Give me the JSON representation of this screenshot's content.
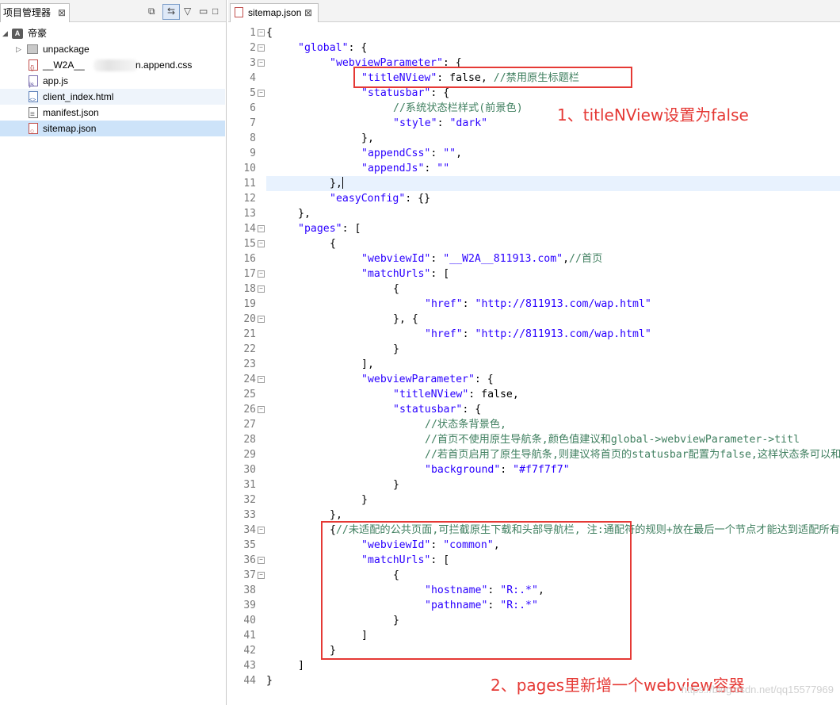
{
  "explorer": {
    "tab_title": "项目管理器",
    "items": [
      {
        "label": "帝豪",
        "type": "project"
      },
      {
        "label": "unpackage",
        "type": "folder"
      },
      {
        "label_prefix": "__W2A__",
        "label_suffix": "n.append.css",
        "type": "css"
      },
      {
        "label": "app.js",
        "type": "js"
      },
      {
        "label": "client_index.html",
        "type": "html"
      },
      {
        "label": "manifest.json",
        "type": "json"
      },
      {
        "label": "sitemap.json",
        "type": "json",
        "selected": true
      }
    ]
  },
  "editor": {
    "tab_title": "sitemap.json",
    "active_line": 11,
    "lines": [
      {
        "num": "1",
        "fold": true,
        "indent": 0,
        "tokens": [
          {
            "t": "{",
            "c": "p"
          }
        ]
      },
      {
        "num": "2",
        "fold": true,
        "indent": 1,
        "tokens": [
          {
            "t": "\"global\"",
            "c": "k"
          },
          {
            "t": ": {",
            "c": "p"
          }
        ]
      },
      {
        "num": "3",
        "fold": true,
        "indent": 2,
        "tokens": [
          {
            "t": "\"webviewParameter\"",
            "c": "k"
          },
          {
            "t": ": {",
            "c": "p"
          }
        ]
      },
      {
        "num": "4",
        "fold": false,
        "indent": 3,
        "tokens": [
          {
            "t": "\"titleNView\"",
            "c": "k"
          },
          {
            "t": ": false, ",
            "c": "p"
          },
          {
            "t": "//禁用原生标题栏",
            "c": "c"
          }
        ]
      },
      {
        "num": "5",
        "fold": true,
        "indent": 3,
        "tokens": [
          {
            "t": "\"statusbar\"",
            "c": "k"
          },
          {
            "t": ": {",
            "c": "p"
          }
        ]
      },
      {
        "num": "6",
        "fold": false,
        "indent": 4,
        "tokens": [
          {
            "t": "//系统状态栏样式(前景色)",
            "c": "c"
          }
        ]
      },
      {
        "num": "7",
        "fold": false,
        "indent": 4,
        "tokens": [
          {
            "t": "\"style\"",
            "c": "k"
          },
          {
            "t": ": ",
            "c": "p"
          },
          {
            "t": "\"dark\"",
            "c": "s"
          }
        ]
      },
      {
        "num": "8",
        "fold": false,
        "indent": 3,
        "tokens": [
          {
            "t": "},",
            "c": "p"
          }
        ]
      },
      {
        "num": "9",
        "fold": false,
        "indent": 3,
        "tokens": [
          {
            "t": "\"appendCss\"",
            "c": "k"
          },
          {
            "t": ": ",
            "c": "p"
          },
          {
            "t": "\"\"",
            "c": "s"
          },
          {
            "t": ",",
            "c": "p"
          }
        ]
      },
      {
        "num": "10",
        "fold": false,
        "indent": 3,
        "tokens": [
          {
            "t": "\"appendJs\"",
            "c": "k"
          },
          {
            "t": ": ",
            "c": "p"
          },
          {
            "t": "\"\"",
            "c": "s"
          }
        ]
      },
      {
        "num": "11",
        "fold": false,
        "indent": 2,
        "tokens": [
          {
            "t": "},",
            "c": "p"
          }
        ],
        "cursor": true
      },
      {
        "num": "12",
        "fold": false,
        "indent": 2,
        "tokens": [
          {
            "t": "\"easyConfig\"",
            "c": "k"
          },
          {
            "t": ": {}",
            "c": "p"
          }
        ]
      },
      {
        "num": "13",
        "fold": false,
        "indent": 1,
        "tokens": [
          {
            "t": "},",
            "c": "p"
          }
        ]
      },
      {
        "num": "14",
        "fold": true,
        "indent": 1,
        "tokens": [
          {
            "t": "\"pages\"",
            "c": "k"
          },
          {
            "t": ": [",
            "c": "p"
          }
        ]
      },
      {
        "num": "15",
        "fold": true,
        "indent": 2,
        "tokens": [
          {
            "t": "{",
            "c": "p"
          }
        ]
      },
      {
        "num": "16",
        "fold": false,
        "indent": 3,
        "tokens": [
          {
            "t": "\"webviewId\"",
            "c": "k"
          },
          {
            "t": ": ",
            "c": "p"
          },
          {
            "t": "\"__W2A__811913.com\"",
            "c": "s"
          },
          {
            "t": ",",
            "c": "p"
          },
          {
            "t": "//首页",
            "c": "c"
          }
        ]
      },
      {
        "num": "17",
        "fold": true,
        "indent": 3,
        "tokens": [
          {
            "t": "\"matchUrls\"",
            "c": "k"
          },
          {
            "t": ": [",
            "c": "p"
          }
        ]
      },
      {
        "num": "18",
        "fold": true,
        "indent": 4,
        "tokens": [
          {
            "t": "{",
            "c": "p"
          }
        ]
      },
      {
        "num": "19",
        "fold": false,
        "indent": 5,
        "tokens": [
          {
            "t": "\"href\"",
            "c": "k"
          },
          {
            "t": ": ",
            "c": "p"
          },
          {
            "t": "\"http://811913.com/wap.html\"",
            "c": "s"
          }
        ]
      },
      {
        "num": "20",
        "fold": true,
        "indent": 4,
        "tokens": [
          {
            "t": "}, {",
            "c": "p"
          }
        ]
      },
      {
        "num": "21",
        "fold": false,
        "indent": 5,
        "tokens": [
          {
            "t": "\"href\"",
            "c": "k"
          },
          {
            "t": ": ",
            "c": "p"
          },
          {
            "t": "\"http://811913.com/wap.html\"",
            "c": "s"
          }
        ]
      },
      {
        "num": "22",
        "fold": false,
        "indent": 4,
        "tokens": [
          {
            "t": "}",
            "c": "p"
          }
        ]
      },
      {
        "num": "23",
        "fold": false,
        "indent": 3,
        "tokens": [
          {
            "t": "],",
            "c": "p"
          }
        ]
      },
      {
        "num": "24",
        "fold": true,
        "indent": 3,
        "tokens": [
          {
            "t": "\"webviewParameter\"",
            "c": "k"
          },
          {
            "t": ": {",
            "c": "p"
          }
        ]
      },
      {
        "num": "25",
        "fold": false,
        "indent": 4,
        "tokens": [
          {
            "t": "\"titleNView\"",
            "c": "k"
          },
          {
            "t": ": false,",
            "c": "p"
          }
        ]
      },
      {
        "num": "26",
        "fold": true,
        "indent": 4,
        "tokens": [
          {
            "t": "\"statusbar\"",
            "c": "k"
          },
          {
            "t": ": {",
            "c": "p"
          }
        ]
      },
      {
        "num": "27",
        "fold": false,
        "indent": 5,
        "tokens": [
          {
            "t": "//状态条背景色,",
            "c": "c"
          }
        ]
      },
      {
        "num": "28",
        "fold": false,
        "indent": 5,
        "tokens": [
          {
            "t": "//首页不使用原生导航条,颜色值建议和global->webviewParameter->titl",
            "c": "c"
          }
        ]
      },
      {
        "num": "29",
        "fold": false,
        "indent": 5,
        "tokens": [
          {
            "t": "//若首页启用了原生导航条,则建议将首页的statusbar配置为false,这样状态条可以和",
            "c": "c"
          }
        ]
      },
      {
        "num": "30",
        "fold": false,
        "indent": 5,
        "tokens": [
          {
            "t": "\"background\"",
            "c": "k"
          },
          {
            "t": ": ",
            "c": "p"
          },
          {
            "t": "\"#f7f7f7\"",
            "c": "s"
          }
        ]
      },
      {
        "num": "31",
        "fold": false,
        "indent": 4,
        "tokens": [
          {
            "t": "}",
            "c": "p"
          }
        ]
      },
      {
        "num": "32",
        "fold": false,
        "indent": 3,
        "tokens": [
          {
            "t": "}",
            "c": "p"
          }
        ]
      },
      {
        "num": "33",
        "fold": false,
        "indent": 2,
        "tokens": [
          {
            "t": "},",
            "c": "p"
          }
        ]
      },
      {
        "num": "34",
        "fold": true,
        "indent": 2,
        "tokens": [
          {
            "t": "{",
            "c": "p"
          },
          {
            "t": "//未适配的公共页面,可拦截原生下载和头部导航栏, 注:通配符的规则+放在最后一个节点才能达到适配所有未适配",
            "c": "c"
          }
        ]
      },
      {
        "num": "35",
        "fold": false,
        "indent": 3,
        "tokens": [
          {
            "t": "\"webviewId\"",
            "c": "k"
          },
          {
            "t": ": ",
            "c": "p"
          },
          {
            "t": "\"common\"",
            "c": "s"
          },
          {
            "t": ",",
            "c": "p"
          }
        ]
      },
      {
        "num": "36",
        "fold": true,
        "indent": 3,
        "tokens": [
          {
            "t": "\"matchUrls\"",
            "c": "k"
          },
          {
            "t": ": [",
            "c": "p"
          }
        ]
      },
      {
        "num": "37",
        "fold": true,
        "indent": 4,
        "tokens": [
          {
            "t": "{",
            "c": "p"
          }
        ]
      },
      {
        "num": "38",
        "fold": false,
        "indent": 5,
        "tokens": [
          {
            "t": "\"hostname\"",
            "c": "k"
          },
          {
            "t": ": ",
            "c": "p"
          },
          {
            "t": "\"R:.*\"",
            "c": "s"
          },
          {
            "t": ",",
            "c": "p"
          }
        ]
      },
      {
        "num": "39",
        "fold": false,
        "indent": 5,
        "tokens": [
          {
            "t": "\"pathname\"",
            "c": "k"
          },
          {
            "t": ": ",
            "c": "p"
          },
          {
            "t": "\"R:.*\"",
            "c": "s"
          }
        ]
      },
      {
        "num": "40",
        "fold": false,
        "indent": 4,
        "tokens": [
          {
            "t": "}",
            "c": "p"
          }
        ]
      },
      {
        "num": "41",
        "fold": false,
        "indent": 3,
        "tokens": [
          {
            "t": "]",
            "c": "p"
          }
        ]
      },
      {
        "num": "42",
        "fold": false,
        "indent": 2,
        "tokens": [
          {
            "t": "}",
            "c": "p"
          }
        ]
      },
      {
        "num": "43",
        "fold": false,
        "indent": 1,
        "tokens": [
          {
            "t": "]",
            "c": "p"
          }
        ]
      },
      {
        "num": "44",
        "fold": false,
        "indent": 0,
        "tokens": [
          {
            "t": "}",
            "c": "p"
          }
        ]
      }
    ]
  },
  "annotations": {
    "note1": "1、titleNView设置为false",
    "note2": "2、pages里新增一个webview容器",
    "watermark": "https://blog.csdn.net/qq15577969"
  },
  "colors": {
    "annotation_red": "#e53935",
    "key_blue": "#2a00ff",
    "comment_green": "#3f7f5f",
    "selection": "#cde3f9"
  }
}
